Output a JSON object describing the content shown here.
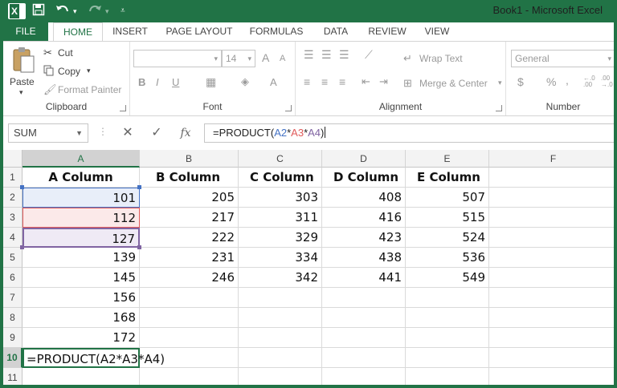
{
  "window": {
    "title": "Book1 - Microsoft Excel",
    "app_icon": "X",
    "quick_access": [
      "save-icon",
      "undo-icon",
      "redo-icon",
      "customize-icon"
    ]
  },
  "tabs": [
    "FILE",
    "HOME",
    "INSERT",
    "PAGE LAYOUT",
    "FORMULAS",
    "DATA",
    "REVIEW",
    "VIEW"
  ],
  "ribbon": {
    "clipboard": {
      "label": "Clipboard",
      "paste": "Paste",
      "cut": "Cut",
      "copy": "Copy",
      "format_painter": "Format Painter"
    },
    "font": {
      "label": "Font",
      "size": "14",
      "grow": "A",
      "shrink": "A",
      "bold": "B",
      "italic": "I",
      "underline": "U",
      "font_color": "A"
    },
    "alignment": {
      "label": "Alignment",
      "wrap_text": "Wrap Text",
      "merge_center": "Merge & Center"
    },
    "number": {
      "label": "Number",
      "format": "General",
      "currency": "$",
      "percent": "%",
      "comma": ",",
      "increase_decimal": "←.0\n.00",
      "decrease_decimal": ".00\n→.0"
    }
  },
  "formula_bar": {
    "name_box": "SUM",
    "cancel": "✕",
    "enter": "✓",
    "fx": "fx",
    "formula_prefix": "=PRODUCT(",
    "ref1": "A2",
    "op1": "*",
    "ref2": "A3",
    "op2": "*",
    "ref3": "A4",
    "formula_suffix": ")"
  },
  "colors": {
    "excel_green": "#217346",
    "ref_blue": "#4472c4",
    "ref_red": "#e05a5a",
    "ref_purple": "#8064a2"
  },
  "grid": {
    "columns": [
      "A",
      "B",
      "C",
      "D",
      "E",
      "F"
    ],
    "rows": [
      "1",
      "2",
      "3",
      "4",
      "5",
      "6",
      "7",
      "8",
      "9",
      "10",
      "11"
    ],
    "headers": [
      "A Column",
      "B Column",
      "C Column",
      "D Column",
      "E Column"
    ],
    "data": [
      [
        "101",
        "205",
        "303",
        "408",
        "507"
      ],
      [
        "112",
        "217",
        "311",
        "416",
        "515"
      ],
      [
        "127",
        "222",
        "329",
        "423",
        "524"
      ],
      [
        "139",
        "231",
        "334",
        "438",
        "536"
      ],
      [
        "145",
        "246",
        "342",
        "441",
        "549"
      ],
      [
        "156",
        "",
        "",
        "",
        ""
      ],
      [
        "168",
        "",
        "",
        "",
        ""
      ],
      [
        "172",
        "",
        "",
        "",
        ""
      ]
    ],
    "edit_cell_text": "=PRODUCT(A2*A3*A4)"
  }
}
